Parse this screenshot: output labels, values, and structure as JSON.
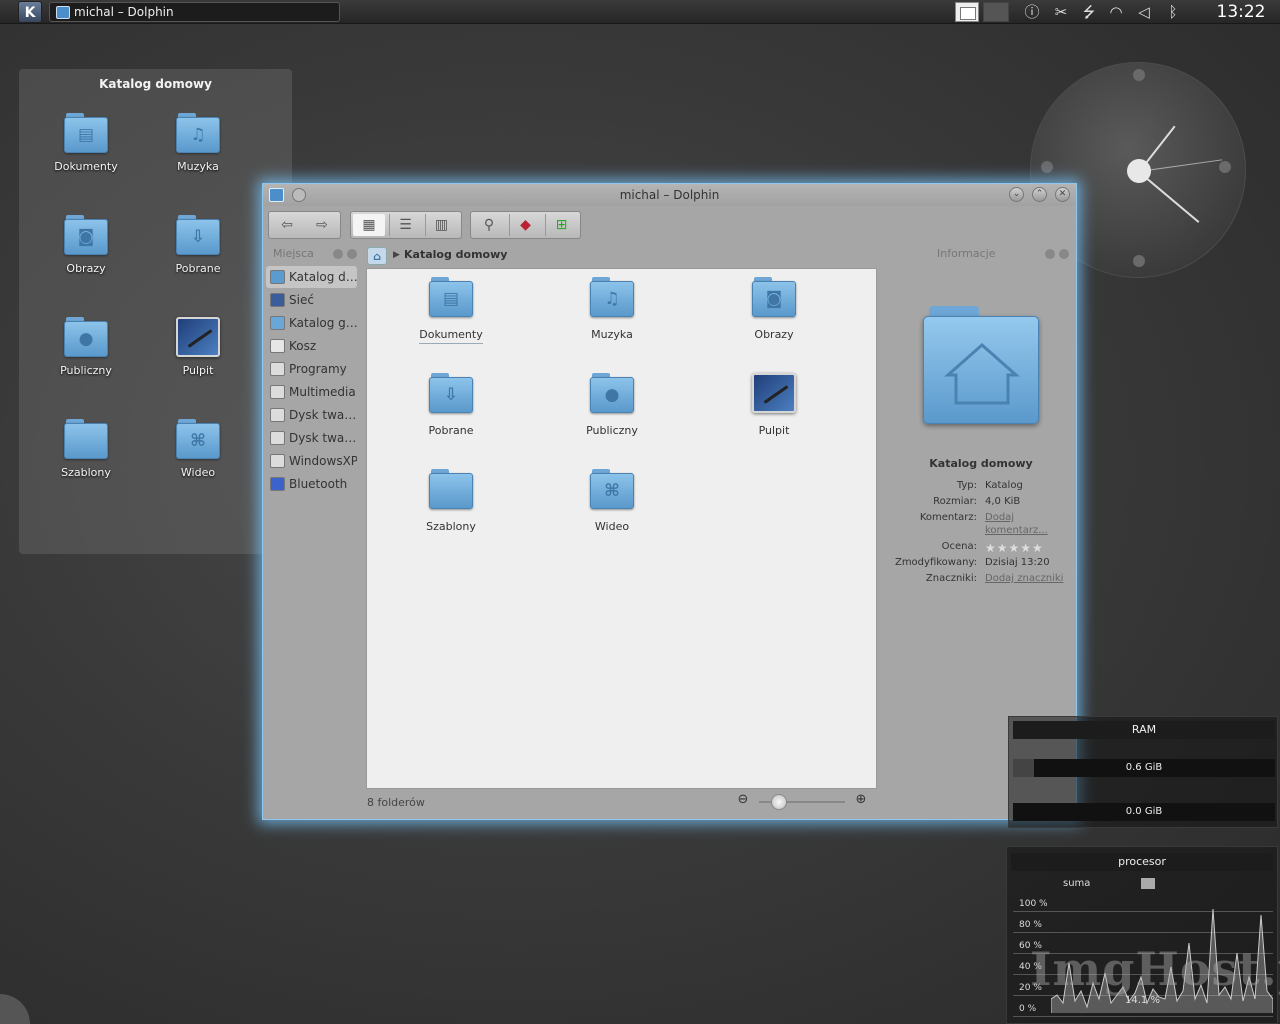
{
  "panel": {
    "task_title": "michal – Dolphin",
    "clock": "13:22"
  },
  "folderview": {
    "title": "Katalog domowy",
    "items": [
      {
        "label": "Dokumenty",
        "icon": "documents-folder-icon",
        "glyph": "▤"
      },
      {
        "label": "Muzyka",
        "icon": "music-folder-icon",
        "glyph": "♫"
      },
      {
        "label": "Obrazy",
        "icon": "pictures-folder-icon",
        "glyph": "◙"
      },
      {
        "label": "Pobrane",
        "icon": "downloads-folder-icon",
        "glyph": "⇩"
      },
      {
        "label": "Publiczny",
        "icon": "public-folder-icon",
        "glyph": "●"
      },
      {
        "label": "Pulpit",
        "icon": "desktop-icon",
        "glyph": ""
      },
      {
        "label": "Szablony",
        "icon": "templates-folder-icon",
        "glyph": ""
      },
      {
        "label": "Wideo",
        "icon": "video-folder-icon",
        "glyph": "⌘"
      }
    ]
  },
  "dolphin": {
    "title": "michal – Dolphin",
    "places_header": "Miejsca",
    "places": [
      {
        "label": "Katalog d…",
        "icon": "home-icon",
        "color": "#5a9bd0"
      },
      {
        "label": "Sieć",
        "icon": "network-icon",
        "color": "#3b5d9a"
      },
      {
        "label": "Katalog g…",
        "icon": "root-folder-icon",
        "color": "#6aa6d8"
      },
      {
        "label": "Kosz",
        "icon": "trash-icon",
        "color": "#e6e6e6"
      },
      {
        "label": "Programy",
        "icon": "drive-icon",
        "color": "#dcdcdc"
      },
      {
        "label": "Multimedia",
        "icon": "drive-icon",
        "color": "#dcdcdc"
      },
      {
        "label": "Dysk twa…",
        "icon": "drive-icon",
        "color": "#dcdcdc"
      },
      {
        "label": "Dysk twa…",
        "icon": "drive-icon",
        "color": "#dcdcdc"
      },
      {
        "label": "WindowsXP",
        "icon": "drive-icon",
        "color": "#dcdcdc"
      },
      {
        "label": "Bluetooth",
        "icon": "bluetooth-icon",
        "color": "#3b63c9"
      }
    ],
    "breadcrumb": "Katalog domowy",
    "files": [
      {
        "label": "Dokumenty",
        "icon": "documents-folder-icon",
        "glyph": "▤"
      },
      {
        "label": "Muzyka",
        "icon": "music-folder-icon",
        "glyph": "♫"
      },
      {
        "label": "Obrazy",
        "icon": "pictures-folder-icon",
        "glyph": "◙"
      },
      {
        "label": "Pobrane",
        "icon": "downloads-folder-icon",
        "glyph": "⇩"
      },
      {
        "label": "Publiczny",
        "icon": "public-folder-icon",
        "glyph": "●"
      },
      {
        "label": "Pulpit",
        "icon": "desktop-icon",
        "glyph": ""
      },
      {
        "label": "Szablony",
        "icon": "templates-folder-icon",
        "glyph": ""
      },
      {
        "label": "Wideo",
        "icon": "video-folder-icon",
        "glyph": "⌘"
      }
    ],
    "status": "8 folderów",
    "info": {
      "header": "Informacje",
      "name": "Katalog domowy",
      "rows": [
        {
          "key": "Typ:",
          "value": "Katalog"
        },
        {
          "key": "Rozmiar:",
          "value": "4,0 KiB"
        },
        {
          "key": "Komentarz:",
          "value": "Dodaj",
          "value2": "komentarz..."
        },
        {
          "key": "Ocena:",
          "value": "★★★★★"
        },
        {
          "key": "Zmodyfikowany:",
          "value": "Dzisiaj 13:20"
        },
        {
          "key": "Znaczniki:",
          "value": "Dodaj znaczniki"
        }
      ]
    }
  },
  "ram": {
    "title": "RAM",
    "used": "0.6 GiB",
    "swap": "0.0 GiB"
  },
  "cpu": {
    "title": "procesor",
    "legend": "suma",
    "y_labels": [
      "100 %",
      "80 %",
      "60 %",
      "40 %",
      "20 %",
      "0 %"
    ],
    "current": "14.1 %"
  },
  "watermark": "ImgHost.pl"
}
